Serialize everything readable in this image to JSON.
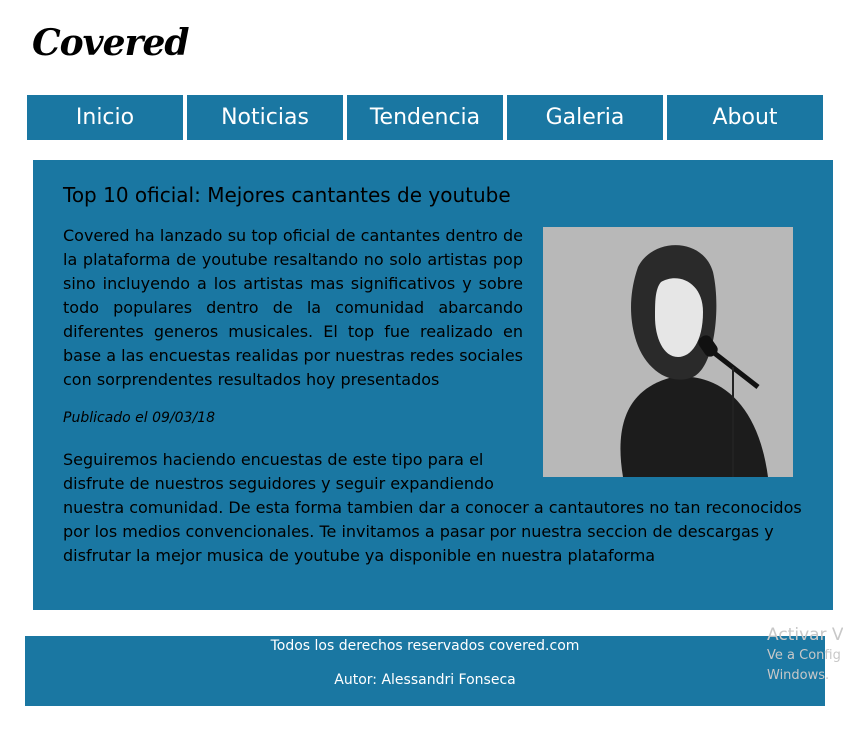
{
  "site": {
    "logo": "Covered"
  },
  "nav": {
    "items": [
      {
        "label": "Inicio"
      },
      {
        "label": "Noticias"
      },
      {
        "label": "Tendencia"
      },
      {
        "label": "Galeria"
      },
      {
        "label": "About"
      }
    ]
  },
  "article": {
    "title": "Top 10 oficial: Mejores cantantes de youtube",
    "brand": "Covered",
    "body_rest": " ha lanzado su top oficial de cantantes dentro de la plataforma de youtube resaltando no solo artistas pop sino incluyendo a los artistas mas significativos y sobre todo populares dentro de la comunidad abarcando diferentes generos musicales. El top fue realizado en base a las encuestas realidas por nuestras redes sociales con sorprendentes resultados hoy presentados",
    "published": "Publicado el 09/03/18",
    "body2": "Seguiremos haciendo encuestas de este tipo para el disfrute de nuestros seguidores y seguir expandiendo nuestra comunidad. De esta forma tambien dar a conocer a cantautores no tan reconocidos por los medios convencionales. Te invitamos a pasar por nuestra seccion de descargas y disfrutar la mejor musica de youtube ya disponible en nuestra plataforma",
    "image_icon": "singer-portrait"
  },
  "footer": {
    "rights": "Todos los derechos reservados covered.com",
    "author": "Autor: Alessandri Fonseca"
  },
  "watermark": {
    "title": "Activar V",
    "line1": "Ve a Config",
    "line2": "Windows."
  },
  "colors": {
    "primary": "#1a77a2",
    "nav_text": "#ffffff",
    "body_text": "#000000"
  }
}
